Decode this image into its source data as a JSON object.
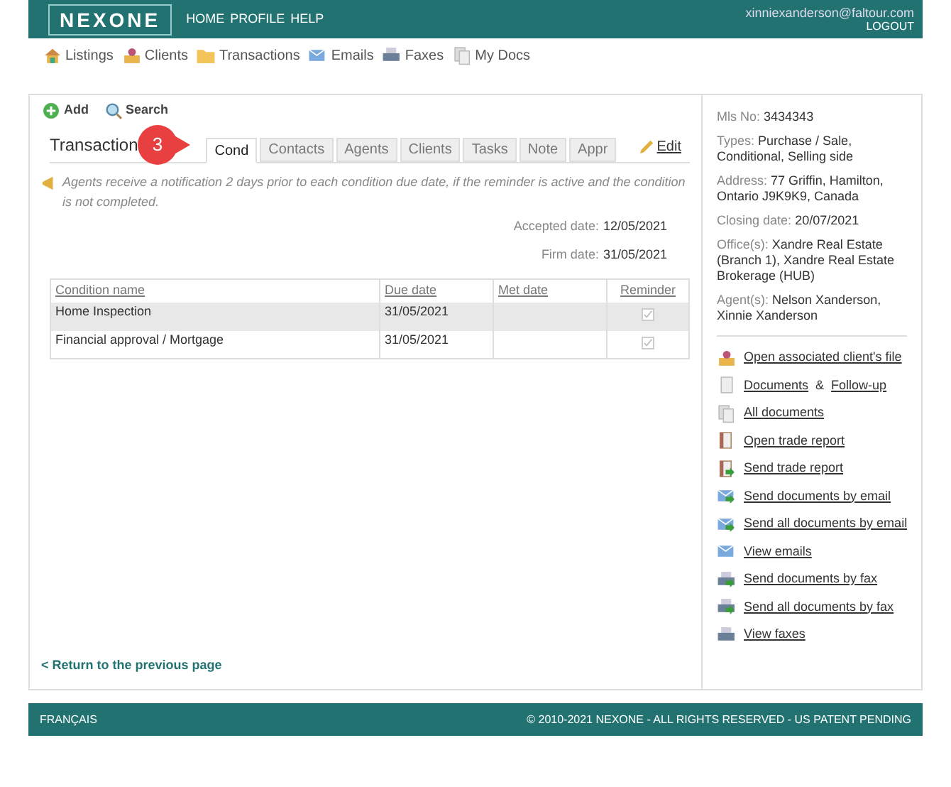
{
  "header": {
    "logo": "NEXONE",
    "menu": [
      "HOME",
      "PROFILE",
      "HELP"
    ],
    "user_email": "xinniexanderson@faltour.com",
    "logout": "LOGOUT"
  },
  "nav": [
    {
      "label": "Listings",
      "kind": "house"
    },
    {
      "label": "Clients",
      "kind": "person"
    },
    {
      "label": "Transactions",
      "kind": "folder"
    },
    {
      "label": "Emails",
      "kind": "mail"
    },
    {
      "label": "Faxes",
      "kind": "printer"
    },
    {
      "label": "My Docs",
      "kind": "docs"
    }
  ],
  "toolbar": [
    {
      "label": "Add",
      "kind": "add"
    },
    {
      "label": "Search",
      "kind": "search"
    }
  ],
  "section_title": "Transaction",
  "callout": "3",
  "tabs": [
    {
      "label": "Cond",
      "selected": true
    },
    {
      "label": "Contacts",
      "selected": false
    },
    {
      "label": "Agents",
      "selected": false
    },
    {
      "label": "Clients",
      "selected": false
    },
    {
      "label": "Tasks",
      "selected": false
    },
    {
      "label": "Note",
      "selected": false
    },
    {
      "label": "Appr",
      "selected": false
    }
  ],
  "edit": "Edit",
  "notice": "Agents receive a notification 2 days prior to each condition due date, if the reminder is active and the condition is not completed.",
  "dates": [
    {
      "label": "Accepted date:",
      "value": "12/05/2021"
    },
    {
      "label": "Firm date:",
      "value": "31/05/2021"
    }
  ],
  "table": {
    "columns": [
      "Condition name",
      "Due date",
      "Met date",
      "Reminder"
    ],
    "rows": [
      {
        "name": "Home Inspection",
        "due": "31/05/2021",
        "reminder": true,
        "selected": true
      },
      {
        "name": "Financial approval / Mortgage",
        "due": "31/05/2021",
        "reminder": true,
        "selected": false
      }
    ]
  },
  "back_link": "< Return to the previous page",
  "details": [
    {
      "label": "Mls No:",
      "value": "3434343"
    },
    {
      "label": "Types:",
      "value": "Purchase / Sale, Conditional, Selling side"
    },
    {
      "label": "Address:",
      "value": "77 Griffin, Hamilton, Ontario J9K9K9, Canada"
    },
    {
      "label": "Closing date:",
      "value": "20/07/2021"
    },
    {
      "label": "Office(s):",
      "value": "Xandre Real Estate (Branch 1), Xandre Real Estate Brokerage (HUB)"
    },
    {
      "label": "Agent(s):",
      "value": "Nelson Xanderson, Xinnie Xanderson"
    }
  ],
  "actions": [
    {
      "kind": "person",
      "links": [
        "Open associated client's file"
      ]
    },
    {
      "kind": "doc",
      "links": [
        "Documents",
        "Follow-up"
      ],
      "joiner": "&"
    },
    {
      "kind": "docs",
      "links": [
        "All documents"
      ]
    },
    {
      "kind": "report",
      "links": [
        "Open trade report"
      ]
    },
    {
      "kind": "report-send",
      "links": [
        "Send trade report"
      ]
    },
    {
      "kind": "mail-send",
      "links": [
        "Send documents by email"
      ]
    },
    {
      "kind": "mail-send",
      "links": [
        "Send all documents by email"
      ]
    },
    {
      "kind": "mail",
      "links": [
        "View emails"
      ]
    },
    {
      "kind": "printer-send",
      "links": [
        "Send documents by fax"
      ]
    },
    {
      "kind": "printer-send",
      "links": [
        "Send all documents by fax"
      ]
    },
    {
      "kind": "printer",
      "links": [
        "View faxes"
      ]
    }
  ],
  "footer": {
    "language": "FRANÇAIS",
    "copyright": "© 2010-2021 NEXONE - ALL RIGHTS RESERVED - US PATENT PENDING"
  }
}
